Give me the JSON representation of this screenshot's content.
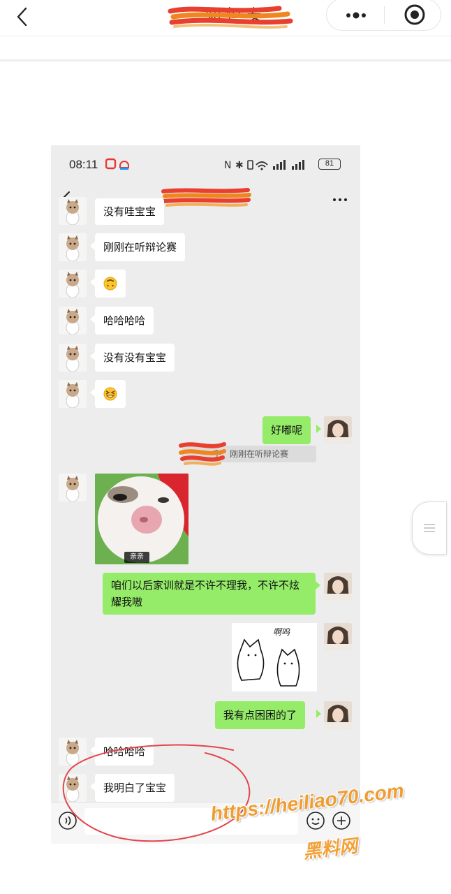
{
  "outer": {
    "title": "知 恒 安",
    "icons": {
      "back": "chevron-left-icon",
      "more": "more-dots-icon",
      "close": "target-circle-icon",
      "handle": "menu-lines-icon"
    }
  },
  "phone": {
    "status": {
      "time": "08:11",
      "battery": "81"
    },
    "chat": {
      "messages": [
        {
          "side": "left",
          "type": "text",
          "text": "没有哇宝宝"
        },
        {
          "side": "left",
          "type": "text",
          "text": "刚刚在听辩论赛"
        },
        {
          "side": "left",
          "type": "emoji",
          "icon": "upside-down-face-emoji"
        },
        {
          "side": "left",
          "type": "text",
          "text": "哈哈哈哈"
        },
        {
          "side": "left",
          "type": "text",
          "text": "没有没有宝宝"
        },
        {
          "side": "left",
          "type": "emoji",
          "icon": "grinning-squint-emoji"
        },
        {
          "side": "right",
          "type": "text",
          "text": "好嘟呢"
        },
        {
          "side": "right",
          "type": "quote",
          "text": "宇：刚刚在听辩论赛"
        },
        {
          "side": "left",
          "type": "sticker",
          "caption": "亲亲"
        },
        {
          "side": "right",
          "type": "text",
          "text": "咱们以后家训就是不许不理我，不许不炫耀我嗷"
        },
        {
          "side": "right",
          "type": "sticker",
          "caption": "啊呜"
        },
        {
          "side": "right",
          "type": "text",
          "text": "我有点困困的了"
        },
        {
          "side": "left",
          "type": "text",
          "text": "哈哈哈哈"
        },
        {
          "side": "left",
          "type": "text",
          "text": "我明白了宝宝"
        }
      ]
    }
  },
  "watermark": {
    "url": "https://heiliao70.com",
    "name": "黑料网"
  },
  "colors": {
    "me_bubble": "#95ec69",
    "other_bubble": "#ffffff",
    "chat_bg": "#ededed",
    "annotation": "#e2464f",
    "watermark": "#ef9d32"
  }
}
